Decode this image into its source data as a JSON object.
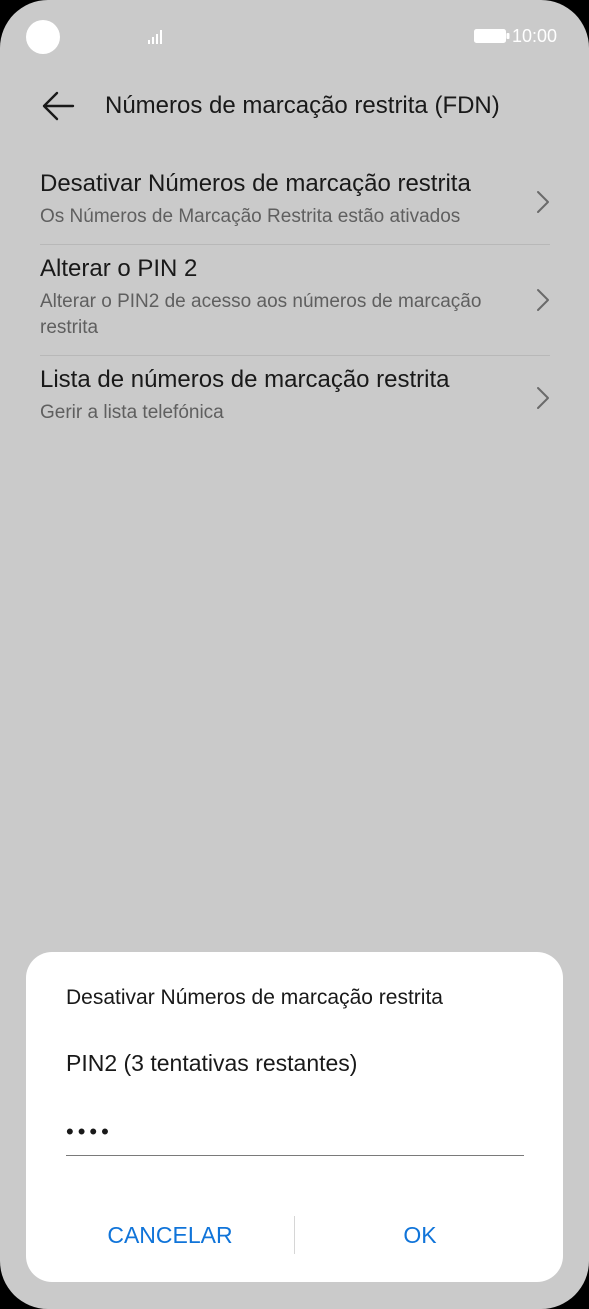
{
  "status_bar": {
    "time": "10:00",
    "icons": [
      "camera-cutout",
      "signal-icon",
      "battery-icon"
    ]
  },
  "header": {
    "back_icon": "arrow-left-icon",
    "title": "Números de marcação restrita (FDN)"
  },
  "settings": {
    "items": [
      {
        "title": "Desativar Números de marcação restrita",
        "subtitle": "Os Números de Marcação Restrita estão ativados"
      },
      {
        "title": "Alterar o PIN 2",
        "subtitle": "Alterar o PIN2 de acesso aos números de marcação restrita"
      },
      {
        "title": "Lista de números de marcação restrita",
        "subtitle": "Gerir a lista telefónica"
      }
    ]
  },
  "dialog": {
    "title": "Desativar Números de marcação restrita",
    "label": "PIN2 (3 tentativas restantes)",
    "pin_value": "••••",
    "cancel_label": "CANCELAR",
    "ok_label": "OK"
  },
  "colors": {
    "background": "#cacaca",
    "accent": "#1074d9",
    "text_primary": "#191919",
    "text_secondary": "#5f5f5f"
  }
}
